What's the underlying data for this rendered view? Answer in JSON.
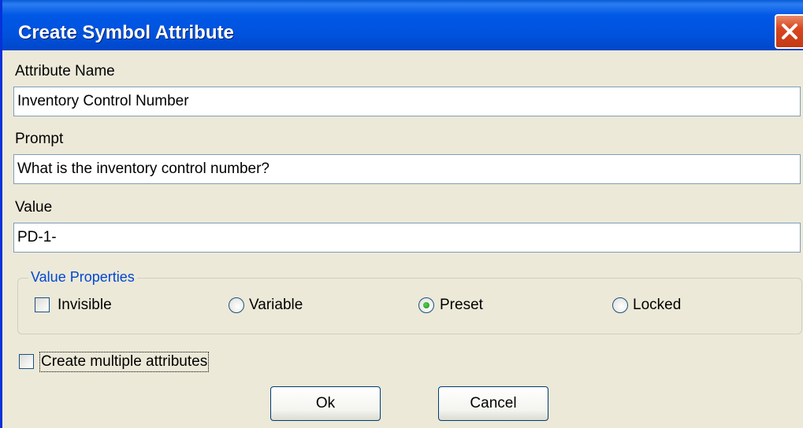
{
  "window": {
    "title": "Create Symbol Attribute",
    "close_icon": "close-icon"
  },
  "fields": {
    "attribute_name": {
      "label": "Attribute Name",
      "value": "Inventory Control Number"
    },
    "prompt": {
      "label": "Prompt",
      "value": "What is the inventory control number?"
    },
    "value": {
      "label": "Value",
      "value": "PD-1-"
    }
  },
  "value_properties": {
    "legend": "Value Properties",
    "invisible": {
      "label": "Invisible",
      "checked": false
    },
    "options": [
      {
        "label": "Variable",
        "selected": false
      },
      {
        "label": "Preset",
        "selected": true
      },
      {
        "label": "Locked",
        "selected": false
      }
    ]
  },
  "create_multiple": {
    "label": "Create multiple attributes",
    "checked": false
  },
  "buttons": {
    "ok": "Ok",
    "cancel": "Cancel"
  },
  "colors": {
    "titlebar": "#0058e6",
    "group_legend": "#0046d5",
    "dialog_bg": "#ece9d8",
    "close_button": "#d9461e"
  }
}
